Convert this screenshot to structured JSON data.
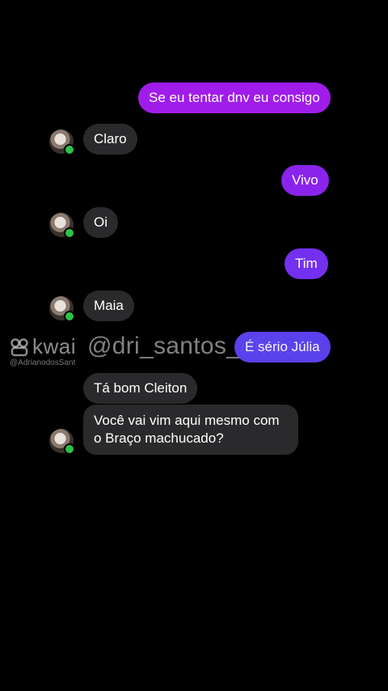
{
  "colors": {
    "background": "#000000",
    "incoming_bubble": "#2a2a2c",
    "online_dot": "#31c048",
    "outgoing_gradient": [
      "#a21ce8",
      "#7a2cf0",
      "#5e44f5"
    ]
  },
  "messages": [
    {
      "side": "out",
      "text": "Se eu tentar dnv eu consigo"
    },
    {
      "side": "in",
      "text": "Claro"
    },
    {
      "side": "out",
      "text": "Vivo"
    },
    {
      "side": "in",
      "text": "Oi"
    },
    {
      "side": "out",
      "text": "Tim"
    },
    {
      "side": "in",
      "text": "Maia"
    },
    {
      "side": "out",
      "text": "É sério Júlia"
    },
    {
      "side": "in",
      "text": "Tá bom Cleiton"
    },
    {
      "side": "in",
      "text": "Você vai vim aqui mesmo com o Braço machucado?"
    }
  ],
  "watermark": {
    "brand": "kwai",
    "brand_icon": "kwai-logo-icon",
    "user_small": "@AdrianodosSant",
    "handle": "@dri_santos_oficial"
  }
}
